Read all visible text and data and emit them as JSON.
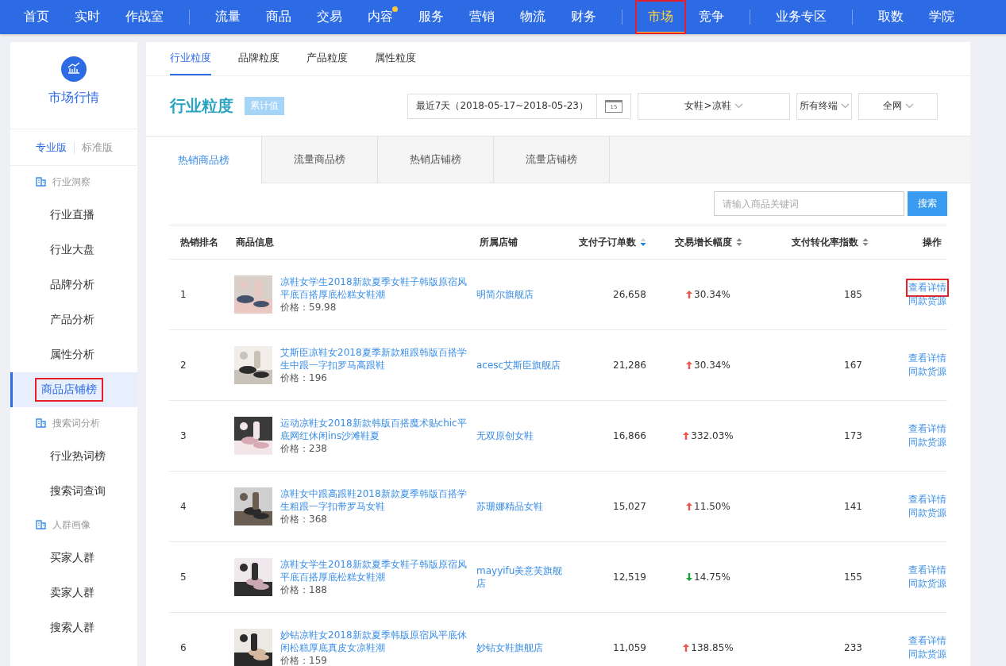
{
  "top_nav": {
    "groups": [
      {
        "items": [
          {
            "label": "首页",
            "selected": false,
            "dot": false,
            "annotated": false
          },
          {
            "label": "实时",
            "selected": false,
            "dot": false,
            "annotated": false
          },
          {
            "label": "作战室",
            "selected": false,
            "dot": false,
            "annotated": false
          }
        ]
      },
      {
        "items": [
          {
            "label": "流量",
            "selected": false,
            "dot": false,
            "annotated": false
          },
          {
            "label": "商品",
            "selected": false,
            "dot": false,
            "annotated": false
          },
          {
            "label": "交易",
            "selected": false,
            "dot": false,
            "annotated": false
          },
          {
            "label": "内容",
            "selected": false,
            "dot": true,
            "annotated": false
          },
          {
            "label": "服务",
            "selected": false,
            "dot": false,
            "annotated": false
          },
          {
            "label": "营销",
            "selected": false,
            "dot": false,
            "annotated": false
          },
          {
            "label": "物流",
            "selected": false,
            "dot": false,
            "annotated": false
          },
          {
            "label": "财务",
            "selected": false,
            "dot": false,
            "annotated": false
          }
        ]
      },
      {
        "items": [
          {
            "label": "市场",
            "selected": true,
            "dot": false,
            "annotated": true
          },
          {
            "label": "竞争",
            "selected": false,
            "dot": false,
            "annotated": false
          }
        ]
      },
      {
        "items": [
          {
            "label": "业务专区",
            "selected": false,
            "dot": false,
            "annotated": false
          }
        ]
      },
      {
        "items": [
          {
            "label": "取数",
            "selected": false,
            "dot": false,
            "annotated": false
          },
          {
            "label": "学院",
            "selected": false,
            "dot": false,
            "annotated": false
          }
        ]
      }
    ]
  },
  "sidebar": {
    "title": "市场行情",
    "editions": [
      {
        "label": "专业版",
        "selected": true
      },
      {
        "label": "标准版",
        "selected": false
      }
    ],
    "sections": [
      {
        "title": "行业洞察",
        "items": [
          {
            "label": "行业直播",
            "selected": false,
            "annotated": false
          },
          {
            "label": "行业大盘",
            "selected": false,
            "annotated": false
          },
          {
            "label": "品牌分析",
            "selected": false,
            "annotated": false
          },
          {
            "label": "产品分析",
            "selected": false,
            "annotated": false
          },
          {
            "label": "属性分析",
            "selected": false,
            "annotated": false
          },
          {
            "label": "商品店铺榜",
            "selected": true,
            "annotated": true
          }
        ]
      },
      {
        "title": "搜索词分析",
        "items": [
          {
            "label": "行业热词榜",
            "selected": false,
            "annotated": false
          },
          {
            "label": "搜索词查询",
            "selected": false,
            "annotated": false
          }
        ]
      },
      {
        "title": "人群画像",
        "items": [
          {
            "label": "买家人群",
            "selected": false,
            "annotated": false
          },
          {
            "label": "卖家人群",
            "selected": false,
            "annotated": false
          },
          {
            "label": "搜索人群",
            "selected": false,
            "annotated": false
          }
        ]
      }
    ]
  },
  "granularity_tabs": [
    {
      "label": "行业粒度",
      "selected": true
    },
    {
      "label": "品牌粒度",
      "selected": false
    },
    {
      "label": "产品粒度",
      "selected": false
    },
    {
      "label": "属性粒度",
      "selected": false
    }
  ],
  "header": {
    "title": "行业粒度",
    "badge": "累计值",
    "date_range": "最近7天（2018-05-17~2018-05-23）",
    "calendar_day": "15",
    "filters": [
      "女鞋>凉鞋",
      "所有终端",
      "全网"
    ]
  },
  "rank_tabs": [
    {
      "label": "热销商品榜",
      "selected": true
    },
    {
      "label": "流量商品榜",
      "selected": false
    },
    {
      "label": "热销店铺榜",
      "selected": false
    },
    {
      "label": "流量店铺榜",
      "selected": false
    }
  ],
  "search": {
    "placeholder": "请输入商品关键词",
    "button": "搜索"
  },
  "table": {
    "columns": [
      {
        "label": "热销排名",
        "sortable": false
      },
      {
        "label": "商品信息",
        "sortable": false
      },
      {
        "label": "所属店铺",
        "sortable": false
      },
      {
        "label": "支付子订单数",
        "sortable": true,
        "sort_active": true
      },
      {
        "label": "交易增长幅度",
        "sortable": true,
        "sort_active": false
      },
      {
        "label": "支付转化率指数",
        "sortable": true,
        "sort_active": false
      },
      {
        "label": "操作",
        "sortable": false
      }
    ],
    "rows": [
      {
        "rank": "1",
        "title": "凉鞋女学生2018新款夏季女鞋子韩版原宿风平底百搭厚底松糕女鞋潮",
        "price": "价格：59.98",
        "store": "明简尔旗舰店",
        "orders": "26,658",
        "growth": "30.34%",
        "rising": true,
        "conversion": "185",
        "actions": [
          {
            "label": "查看详情",
            "annotated": true
          },
          {
            "label": "同款货源",
            "annotated": false
          }
        ]
      },
      {
        "rank": "2",
        "title": "艾斯臣凉鞋女2018夏季新款粗跟韩版百搭学生中跟一字扣罗马高跟鞋",
        "price": "价格：196",
        "store": "acesc艾斯臣旗舰店",
        "orders": "21,286",
        "growth": "30.34%",
        "rising": true,
        "conversion": "167",
        "actions": [
          {
            "label": "查看详情",
            "annotated": false
          },
          {
            "label": "同款货源",
            "annotated": false
          }
        ]
      },
      {
        "rank": "3",
        "title": "运动凉鞋女2018新款韩版百搭魔术贴chic平底网红休闲ins沙滩鞋夏",
        "price": "价格：238",
        "store": "无双原创女鞋",
        "orders": "16,866",
        "growth": "332.03%",
        "rising": true,
        "conversion": "173",
        "actions": [
          {
            "label": "查看详情",
            "annotated": false
          },
          {
            "label": "同款货源",
            "annotated": false
          }
        ]
      },
      {
        "rank": "4",
        "title": "凉鞋女中跟高跟鞋2018新款夏季韩版百搭学生粗跟一字扣带罗马女鞋",
        "price": "价格：368",
        "store": "苏珊娜精品女鞋",
        "orders": "15,027",
        "growth": "11.50%",
        "rising": true,
        "conversion": "141",
        "actions": [
          {
            "label": "查看详情",
            "annotated": false
          },
          {
            "label": "同款货源",
            "annotated": false
          }
        ]
      },
      {
        "rank": "5",
        "title": "凉鞋女学生2018新款夏季女鞋子韩版原宿风平底百搭厚底松糕女鞋潮",
        "price": "价格：188",
        "store": "mayyifu美意芙旗舰店",
        "orders": "12,519",
        "growth": "14.75%",
        "rising": false,
        "conversion": "155",
        "actions": [
          {
            "label": "查看详情",
            "annotated": false
          },
          {
            "label": "同款货源",
            "annotated": false
          }
        ]
      },
      {
        "rank": "6",
        "title": "妙钻凉鞋女2018新款夏季韩版原宿风平底休闲松糕厚底真皮女凉鞋潮",
        "price": "价格：159",
        "store": "妙钻女鞋旗舰店",
        "orders": "11,059",
        "growth": "138.85%",
        "rising": true,
        "conversion": "233",
        "actions": [
          {
            "label": "查看详情",
            "annotated": false
          },
          {
            "label": "同款货源",
            "annotated": false
          }
        ]
      }
    ]
  }
}
